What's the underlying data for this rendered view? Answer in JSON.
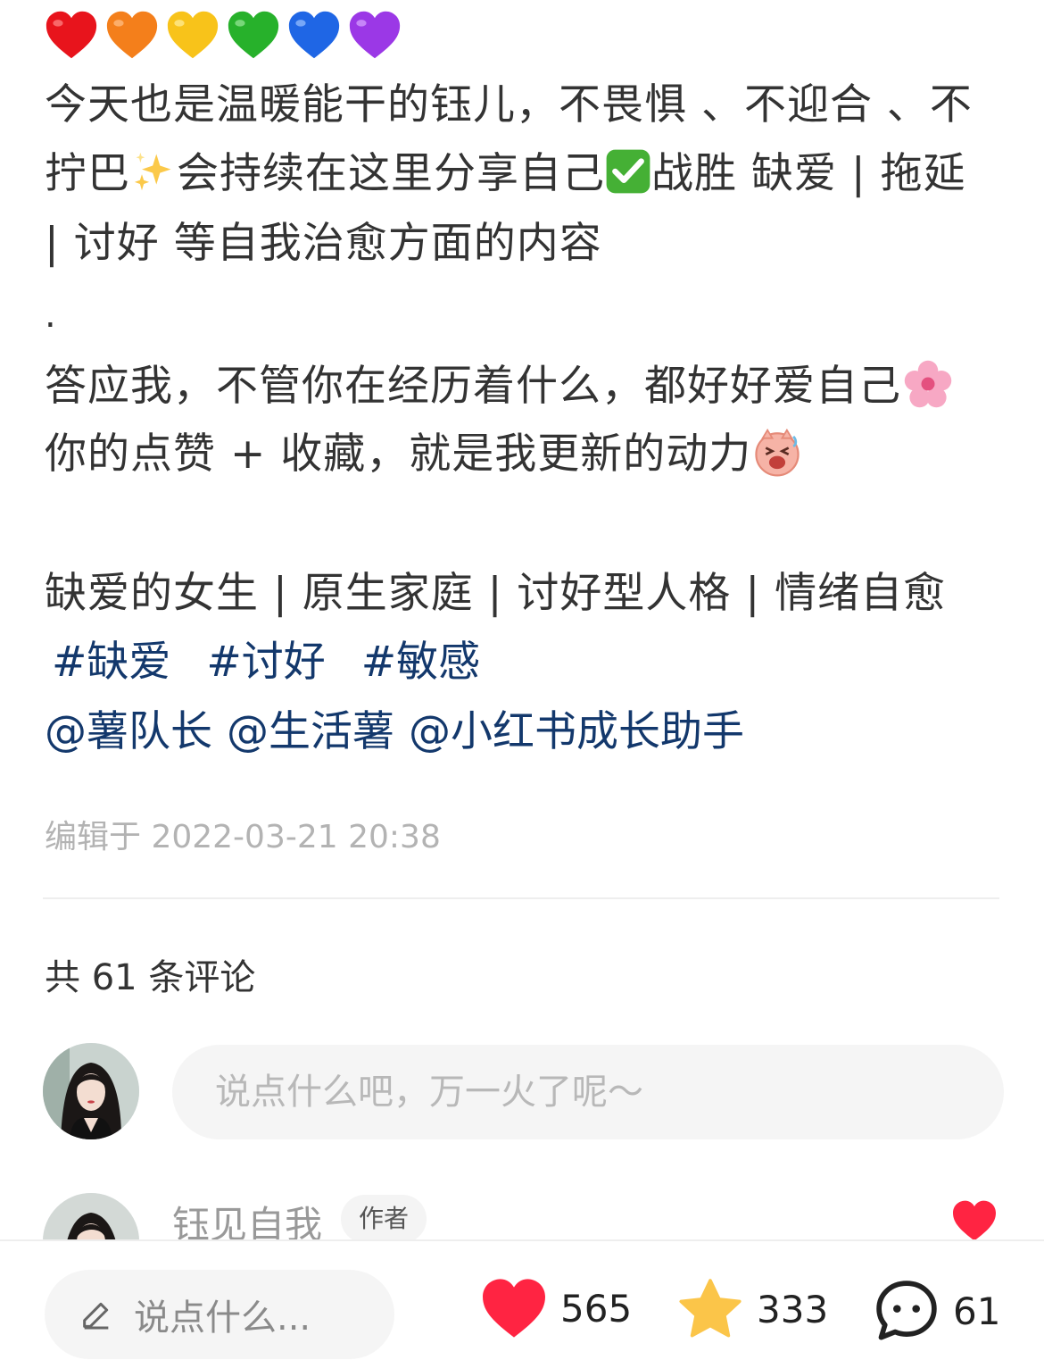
{
  "post": {
    "lines": [
      "今天也是温暖能干的钰儿，不畏惧 、不迎合 、不",
      "拧巴",
      "会持续在这里分享自己",
      "战胜 缺爱 | 拖延",
      "| 讨好 等自我治愈方面的内容",
      ".",
      "答应我，不管你在经历着什么，都好好爱自己",
      "你的点赞 + 收藏，就是我更新的动力",
      "缺爱的女生 | 原生家庭 | 讨好型人格 | 情绪自愈"
    ],
    "hashtags": [
      "#缺爱",
      "#讨好",
      "#敏感"
    ],
    "mentions": [
      "@薯队长",
      "@生活薯",
      "@小红书成长助手"
    ],
    "edited": "编辑于 2022-03-21 20:38"
  },
  "comments": {
    "count_label": "共 61 条评论",
    "input_placeholder": "说点什么吧，万一火了呢～",
    "first_comment": {
      "name": "钰见自我",
      "badge": "作者"
    }
  },
  "bottom_bar": {
    "input_label": "说点什么...",
    "likes": "565",
    "stars": "333",
    "comments": "61"
  },
  "colors": {
    "link": "#13386c",
    "like_red": "#ff2442",
    "star_yellow": "#fbc549"
  },
  "icons": {
    "emoji_row": [
      "red-heart-icon",
      "orange-heart-icon",
      "yellow-heart-icon",
      "green-heart-icon",
      "blue-heart-icon",
      "purple-heart-icon"
    ]
  }
}
